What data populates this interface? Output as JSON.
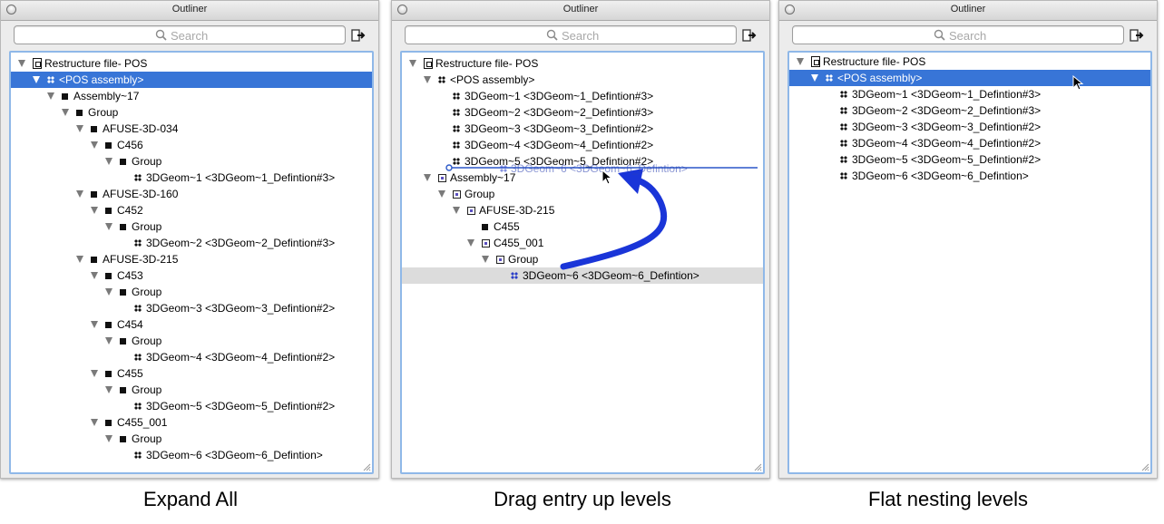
{
  "panels": [
    {
      "title": "Outliner",
      "search_placeholder": "Search",
      "caption": "Expand All",
      "rows": [
        {
          "text": "Restructure file- POS",
          "icon": "file-icon"
        },
        {
          "text": "<POS assembly>",
          "icon": "assembly-icon",
          "selected": true
        },
        {
          "text": "Assembly~17",
          "icon": "node-icon"
        },
        {
          "text": "Group",
          "icon": "node-icon"
        },
        {
          "text": "AFUSE-3D-034",
          "icon": "node-icon"
        },
        {
          "text": "C456",
          "icon": "node-icon"
        },
        {
          "text": "Group",
          "icon": "node-icon"
        },
        {
          "text": "3DGeom~1 <3DGeom~1_Defintion#3>",
          "icon": "geom-icon"
        },
        {
          "text": "AFUSE-3D-160",
          "icon": "node-icon"
        },
        {
          "text": "C452",
          "icon": "node-icon"
        },
        {
          "text": "Group",
          "icon": "node-icon"
        },
        {
          "text": "3DGeom~2 <3DGeom~2_Defintion#3>",
          "icon": "geom-icon"
        },
        {
          "text": "AFUSE-3D-215",
          "icon": "node-icon"
        },
        {
          "text": "C453",
          "icon": "node-icon"
        },
        {
          "text": "Group",
          "icon": "node-icon"
        },
        {
          "text": "3DGeom~3 <3DGeom~3_Defintion#2>",
          "icon": "geom-icon"
        },
        {
          "text": "C454",
          "icon": "node-icon"
        },
        {
          "text": "Group",
          "icon": "node-icon"
        },
        {
          "text": "3DGeom~4 <3DGeom~4_Defintion#2>",
          "icon": "geom-icon"
        },
        {
          "text": "C455",
          "icon": "node-icon"
        },
        {
          "text": "Group",
          "icon": "node-icon"
        },
        {
          "text": "3DGeom~5 <3DGeom~5_Defintion#2>",
          "icon": "geom-icon"
        },
        {
          "text": "C455_001",
          "icon": "node-icon"
        },
        {
          "text": "Group",
          "icon": "node-icon"
        },
        {
          "text": "3DGeom~6 <3DGeom~6_Defintion>",
          "icon": "geom-icon"
        }
      ]
    },
    {
      "title": "Outliner",
      "search_placeholder": "Search",
      "caption": "Drag entry up levels",
      "drag_ghost_text": "3DGeom~6 <3DGeom~6_Defintion>",
      "rows": [
        {
          "text": "Restructure file- POS",
          "icon": "file-icon"
        },
        {
          "text": "<POS assembly>",
          "icon": "assembly-icon"
        },
        {
          "text": "3DGeom~1 <3DGeom~1_Defintion#3>",
          "icon": "geom-icon"
        },
        {
          "text": "3DGeom~2 <3DGeom~2_Defintion#3>",
          "icon": "geom-icon"
        },
        {
          "text": "3DGeom~3 <3DGeom~3_Defintion#2>",
          "icon": "geom-icon"
        },
        {
          "text": "3DGeom~4 <3DGeom~4_Defintion#2>",
          "icon": "geom-icon"
        },
        {
          "text": "3DGeom~5 <3DGeom~5_Defintion#2>",
          "icon": "geom-icon"
        },
        {
          "text": "Assembly~17",
          "icon": "open-node-icon"
        },
        {
          "text": "Group",
          "icon": "open-node-icon"
        },
        {
          "text": "AFUSE-3D-215",
          "icon": "open-node-icon"
        },
        {
          "text": "C455",
          "icon": "node-icon"
        },
        {
          "text": "C455_001",
          "icon": "open-node-icon"
        },
        {
          "text": "Group",
          "icon": "open-node-icon"
        },
        {
          "text": "3DGeom~6 <3DGeom~6_Defintion>",
          "icon": "geom-icon",
          "dragging": true
        }
      ]
    },
    {
      "title": "Outliner",
      "search_placeholder": "Search",
      "caption": "Flat nesting levels",
      "rows": [
        {
          "text": "Restructure file- POS",
          "icon": "file-icon"
        },
        {
          "text": "<POS assembly>",
          "icon": "assembly-icon",
          "selected": true
        },
        {
          "text": "3DGeom~1 <3DGeom~1_Defintion#3>",
          "icon": "geom-icon"
        },
        {
          "text": "3DGeom~2 <3DGeom~2_Defintion#3>",
          "icon": "geom-icon"
        },
        {
          "text": "3DGeom~3 <3DGeom~3_Defintion#2>",
          "icon": "geom-icon"
        },
        {
          "text": "3DGeom~4 <3DGeom~4_Defintion#2>",
          "icon": "geom-icon"
        },
        {
          "text": "3DGeom~5 <3DGeom~5_Defintion#2>",
          "icon": "geom-icon"
        },
        {
          "text": "3DGeom~6 <3DGeom~6_Defintion>",
          "icon": "geom-icon"
        }
      ]
    }
  ],
  "colors": {
    "selection": "#3875d7",
    "tree_border": "#8fb8e8",
    "drag_arrow": "#1a35d8",
    "drag_row": "#dcdcdc"
  }
}
